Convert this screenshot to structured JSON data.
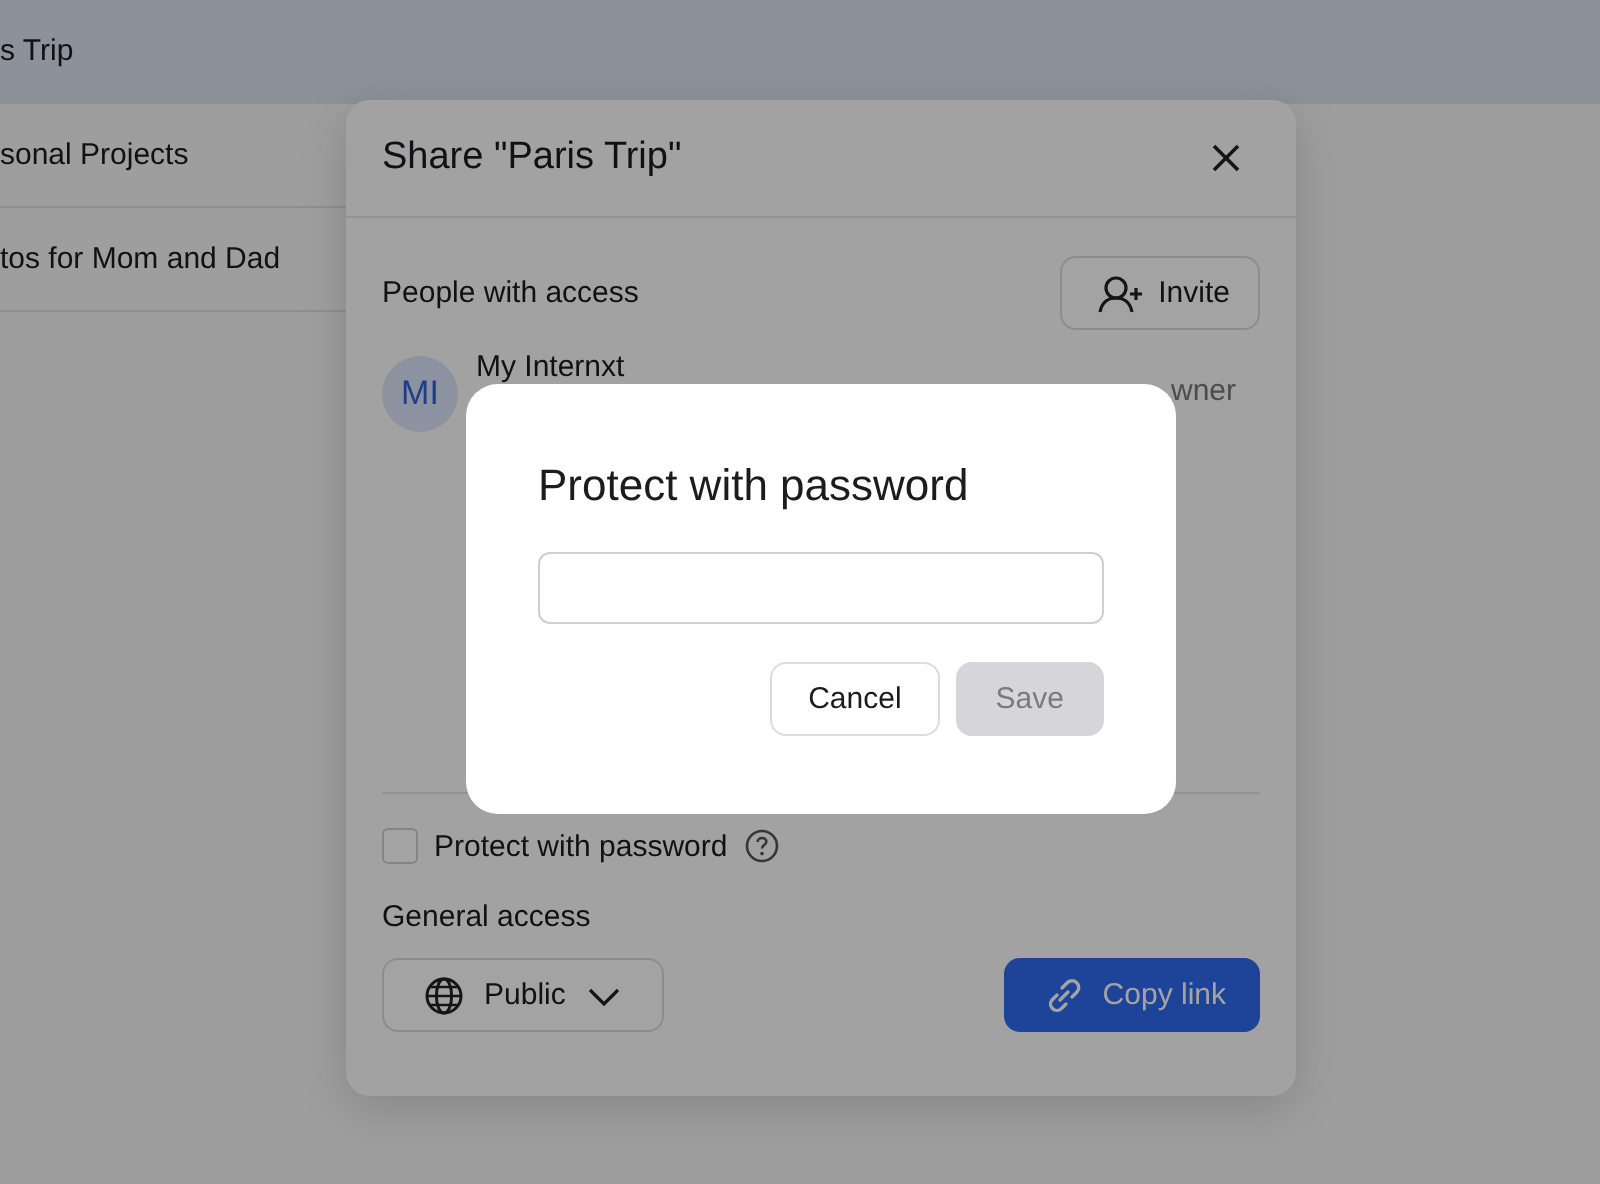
{
  "file_list": [
    {
      "name": "s Trip",
      "selected": true
    },
    {
      "name": "sonal Projects",
      "selected": false
    },
    {
      "name": "tos for Mom and Dad",
      "selected": false
    }
  ],
  "share_dialog": {
    "title": "Share \"Paris Trip\"",
    "people_heading": "People with access",
    "invite_button": "Invite",
    "people": [
      {
        "initials": "MI",
        "name": "My Internxt",
        "role": "wner"
      }
    ],
    "protect": {
      "label": "Protect with password",
      "checked": false
    },
    "general_access_heading": "General access",
    "access_dropdown": "Public",
    "copy_button": "Copy link"
  },
  "password_dialog": {
    "title": "Protect with password",
    "cancel_button": "Cancel",
    "save_button": {
      "label": "Save",
      "disabled": true
    }
  }
}
